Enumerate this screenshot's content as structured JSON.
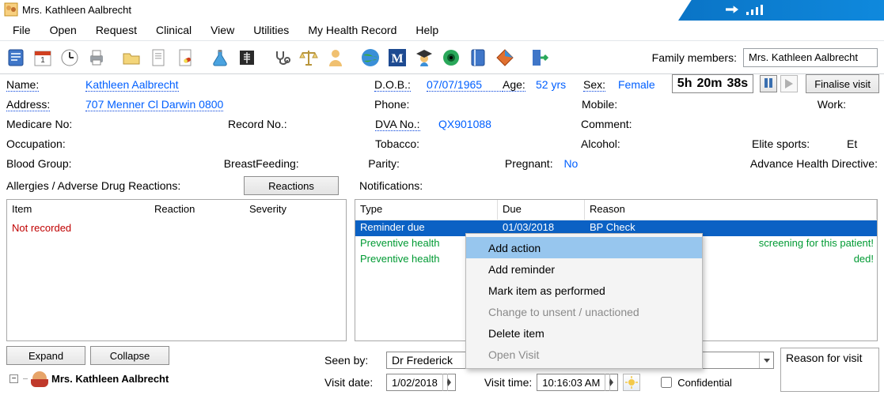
{
  "title": "Mrs. Kathleen Aalbrecht",
  "menu": {
    "file": "File",
    "open": "Open",
    "request": "Request",
    "clinical": "Clinical",
    "view": "View",
    "utilities": "Utilities",
    "mhr": "My Health Record",
    "help": "Help"
  },
  "toolbar": {
    "icons": [
      "file-icon",
      "calendar-icon",
      "clock-icon",
      "print-icon",
      "open-file-icon",
      "page-icon",
      "rx-icon",
      "flask-icon",
      "xray-icon",
      "stethoscope-icon",
      "scale-icon",
      "person-icon",
      "globe-icon",
      "m-icon",
      "grad-icon",
      "eye-icon",
      "book2-icon",
      "diamond-icon",
      "exit-icon"
    ],
    "family_label": "Family members:",
    "family_value": "Mrs. Kathleen Aalbrecht"
  },
  "patient": {
    "name_label": "Name:",
    "name": "Kathleen Aalbrecht",
    "dob_label": "D.O.B.:",
    "dob": "07/07/1965",
    "age_label": "Age:",
    "age": "52 yrs",
    "sex_label": "Sex:",
    "sex": "Female",
    "address_label": "Address:",
    "address": "707 Menner Cl   Darwin   0800",
    "phone_label": "Phone:",
    "mobile_label": "Mobile:",
    "work_label": "Work:",
    "medicare_label": "Medicare No:",
    "record_label": "Record No.:",
    "dva_label": "DVA No.:",
    "dva": "QX901088",
    "comment_label": "Comment:",
    "occupation_label": "Occupation:",
    "tobacco_label": "Tobacco:",
    "alcohol_label": "Alcohol:",
    "elite_label": "Elite sports:",
    "elite_partial": "Et",
    "blood_label": "Blood Group:",
    "breast_label": "BreastFeeding:",
    "parity_label": "Parity:",
    "preg_label": "Pregnant:",
    "preg": "No",
    "advance_label": "Advance Health Directive:"
  },
  "visit_timer": {
    "h": "5h",
    "m": "20m",
    "s": "38s",
    "finalise": "Finalise visit"
  },
  "reactions": {
    "label": "Allergies / Adverse Drug Reactions:",
    "btn": "Reactions",
    "cols": {
      "item": "Item",
      "reaction": "Reaction",
      "severity": "Severity"
    },
    "not_recorded": "Not recorded"
  },
  "notifications": {
    "label": "Notifications:",
    "cols": {
      "type": "Type",
      "due": "Due",
      "reason": "Reason"
    },
    "rows": [
      {
        "type": "Reminder due",
        "due": "01/03/2018",
        "reason": "BP Check"
      },
      {
        "type": "Preventive health",
        "reason": "screening for this patient!"
      },
      {
        "type": "Preventive health",
        "reason": "ded!"
      }
    ]
  },
  "context_menu": [
    {
      "label": "Add action",
      "state": "sel"
    },
    {
      "label": "Add reminder",
      "state": ""
    },
    {
      "label": "Mark item as performed",
      "state": ""
    },
    {
      "label": "Change to unsent / unactioned",
      "state": "dis"
    },
    {
      "label": "Delete item",
      "state": ""
    },
    {
      "label": "Open Visit",
      "state": "dis"
    }
  ],
  "tree": {
    "expand": "Expand",
    "collapse": "Collapse",
    "patient": "Mrs. Kathleen Aalbrecht"
  },
  "visit": {
    "seen_label": "Seen by:",
    "seen_by": "Dr Frederick",
    "date_label": "Visit date:",
    "date": "1/02/2018",
    "time_label": "Visit time:",
    "time": "10:16:03 AM",
    "confidential": "Confidential",
    "reason_label": "Reason for visit"
  }
}
